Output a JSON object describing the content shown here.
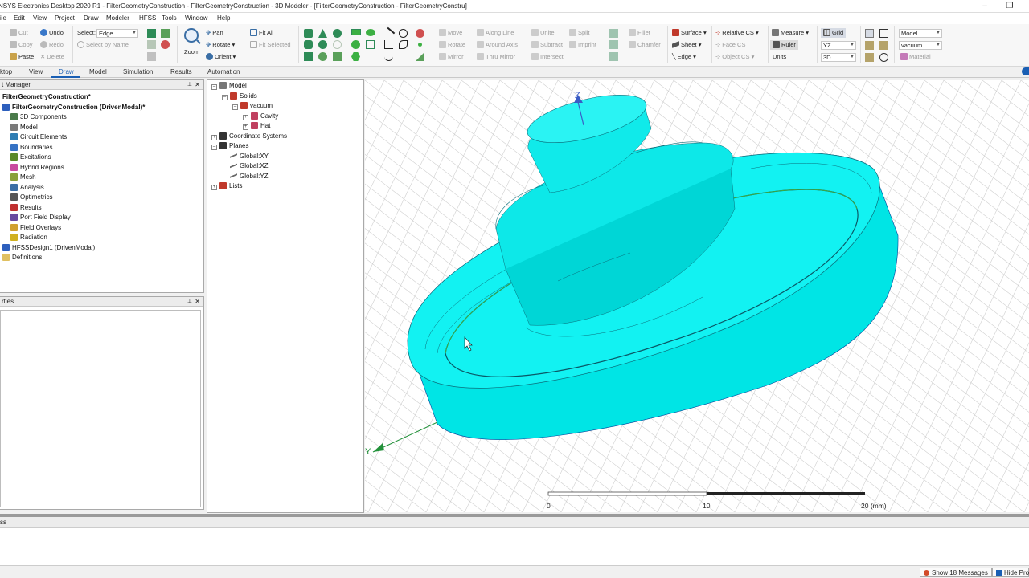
{
  "window": {
    "title": "NSYS Electronics Desktop 2020 R1 - FilterGeometryConstruction - FilterGeometryConstruction - 3D Modeler - [FilterGeometryConstruction - FilterGeometryConstru]",
    "minimize": "–",
    "restore": "❐"
  },
  "menu": [
    "ile",
    "Edit",
    "View",
    "Project",
    "Draw",
    "Modeler",
    "HFSS",
    "Tools",
    "Window",
    "Help"
  ],
  "ribbon": {
    "clipboard": {
      "cut": "Cut",
      "copy": "Copy",
      "paste": "Paste",
      "undo": "Undo",
      "redo": "Redo",
      "delete": "Delete"
    },
    "select": {
      "label": "Select:",
      "value": "Edge",
      "by_name": "Select by Name"
    },
    "view": {
      "pan": "Pan",
      "rotate": "Rotate",
      "orient": "Orient",
      "zoom": "Zoom",
      "fit_all": "Fit All",
      "fit_selected": "Fit Selected"
    },
    "edit": {
      "move": "Move",
      "rotate": "Rotate",
      "mirror": "Mirror",
      "along_line": "Along Line",
      "around_axis": "Around Axis",
      "thru_mirror": "Thru Mirror",
      "unite": "Unite",
      "subtract": "Subtract",
      "intersect": "Intersect",
      "split": "Split",
      "imprint": "Imprint",
      "fillet": "Fillet",
      "chamfer": "Chamfer"
    },
    "sheet": {
      "surface": "Surface",
      "sheet": "Sheet",
      "edge": "Edge"
    },
    "cs": {
      "relative": "Relative CS",
      "face": "Face CS",
      "object": "Object CS"
    },
    "measure": {
      "measure": "Measure",
      "ruler": "Ruler",
      "units": "Units"
    },
    "grid": {
      "label": "Grid",
      "plane": "YZ",
      "mode": "3D"
    },
    "material": {
      "model": "Model",
      "vacuum": "vacuum",
      "material": "Material"
    }
  },
  "tabs": [
    "ktop",
    "View",
    "Draw",
    "Model",
    "Simulation",
    "Results",
    "Automation"
  ],
  "active_tab": "Draw",
  "project_manager": {
    "title": "t Manager",
    "items": [
      {
        "label": "FilterGeometryConstruction*",
        "bold": true,
        "level": 0,
        "icon": "none"
      },
      {
        "label": "FilterGeometryConstruction (DrivenModal)*",
        "bold": true,
        "level": 0,
        "icon": "hfss-design-icon"
      },
      {
        "label": "3D Components",
        "level": 1,
        "icon": "components-icon"
      },
      {
        "label": "Model",
        "level": 1,
        "icon": "model-icon"
      },
      {
        "label": "Circuit Elements",
        "level": 1,
        "icon": "circuit-icon"
      },
      {
        "label": "Boundaries",
        "level": 1,
        "icon": "boundaries-icon"
      },
      {
        "label": "Excitations",
        "level": 1,
        "icon": "excitations-icon"
      },
      {
        "label": "Hybrid Regions",
        "level": 1,
        "icon": "hybrid-icon"
      },
      {
        "label": "Mesh",
        "level": 1,
        "icon": "mesh-icon"
      },
      {
        "label": "Analysis",
        "level": 1,
        "icon": "analysis-icon"
      },
      {
        "label": "Optimetrics",
        "level": 1,
        "icon": "optimetrics-icon"
      },
      {
        "label": "Results",
        "level": 1,
        "icon": "results-icon"
      },
      {
        "label": "Port Field Display",
        "level": 1,
        "icon": "port-field-icon"
      },
      {
        "label": "Field Overlays",
        "level": 1,
        "icon": "field-overlays-icon"
      },
      {
        "label": "Radiation",
        "level": 1,
        "icon": "radiation-icon"
      },
      {
        "label": "HFSSDesign1 (DrivenModal)",
        "level": 0,
        "icon": "hfss-design-icon"
      },
      {
        "label": "Definitions",
        "level": 0,
        "icon": "folder-icon"
      }
    ]
  },
  "properties": {
    "title": "rties"
  },
  "model_tree": [
    {
      "label": "Model",
      "level": 0,
      "exp": "–"
    },
    {
      "label": "Solids",
      "level": 1,
      "exp": "–"
    },
    {
      "label": "vacuum",
      "level": 2,
      "exp": "–"
    },
    {
      "label": "Cavity",
      "level": 3,
      "exp": "+"
    },
    {
      "label": "Hat",
      "level": 3,
      "exp": "+"
    },
    {
      "label": "Coordinate Systems",
      "level": 0,
      "exp": "+"
    },
    {
      "label": "Planes",
      "level": 0,
      "exp": "–"
    },
    {
      "label": "Global:XY",
      "level": 1,
      "exp": ""
    },
    {
      "label": "Global:XZ",
      "level": 1,
      "exp": ""
    },
    {
      "label": "Global:YZ",
      "level": 1,
      "exp": ""
    },
    {
      "label": "Lists",
      "level": 0,
      "exp": "+"
    }
  ],
  "viewport": {
    "axis_z": "Z",
    "axis_y": "Y",
    "scale_labels": [
      "0",
      "10",
      "20 (mm)"
    ],
    "colors": {
      "body": "#00e8e8",
      "highlight_edge": "#3cb043",
      "grid": "#cfcfcf"
    }
  },
  "message_bar": {
    "label": "ss"
  },
  "status": {
    "messages": "Show 18 Messages",
    "hide_progress": "Hide Pro"
  }
}
